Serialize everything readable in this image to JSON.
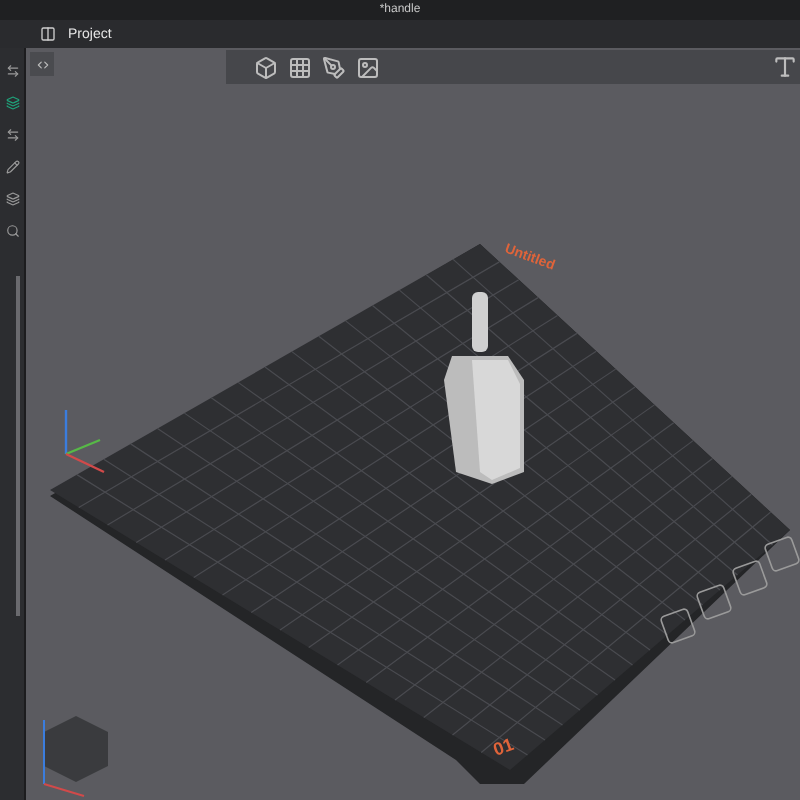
{
  "window": {
    "title": "*handle"
  },
  "tabs": [
    {
      "label": "Project",
      "selected": true
    }
  ],
  "plate": {
    "name": "Untitled",
    "number": "01"
  }
}
